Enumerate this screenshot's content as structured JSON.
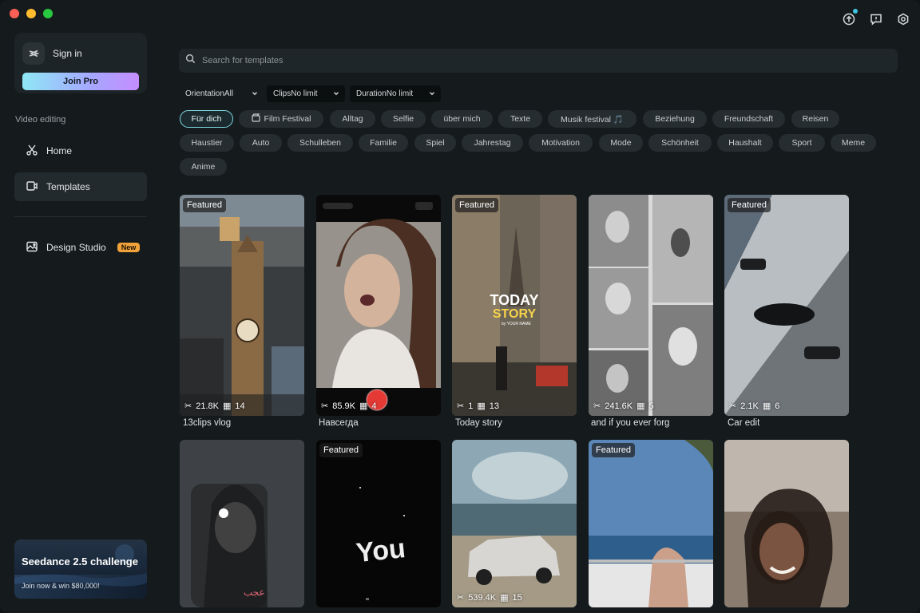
{
  "sidebar": {
    "sign_in": "Sign in",
    "join_pro": "Join Pro",
    "section": "Video editing",
    "items": [
      {
        "label": "Home",
        "icon": "scissors-icon"
      },
      {
        "label": "Templates",
        "icon": "template-icon"
      },
      {
        "label": "Design Studio",
        "icon": "design-icon",
        "badge": "New"
      }
    ],
    "promo": {
      "title": "Seedance 2.5 challenge",
      "subtitle": "Join now & win $80,000!"
    }
  },
  "search": {
    "placeholder": "Search for templates"
  },
  "filters": [
    {
      "label": "Orientation",
      "value": "All"
    },
    {
      "label": "Clips",
      "value": "No limit"
    },
    {
      "label": "Duration",
      "value": "No limit"
    }
  ],
  "chips_row1": [
    "Für dich",
    "Film Festival",
    "Alltag",
    "Selfie",
    "über mich",
    "Texte",
    "Musik festival 🎵",
    "Beziehung",
    "Freundschaft",
    "Reisen"
  ],
  "chips_row2": [
    "Haustier",
    "Auto",
    "Schulleben",
    "Familie",
    "Spiel",
    "Jahrestag",
    "Motivation",
    "Mode",
    "Schönheit",
    "Haushalt",
    "Sport",
    "Meme"
  ],
  "chips_row3": [
    "Anime"
  ],
  "templates": [
    {
      "title": "13clips vlog",
      "featured": "Featured",
      "uses": "21.8K",
      "clips": "14"
    },
    {
      "title": "Навсегда",
      "featured": "",
      "uses": "85.9K",
      "clips": "4"
    },
    {
      "title": "Today story",
      "featured": "Featured",
      "uses": "1",
      "clips": "13"
    },
    {
      "title": "and if you ever forg",
      "featured": "",
      "uses": "241.6K",
      "clips": "5"
    },
    {
      "title": "Car edit",
      "featured": "Featured",
      "uses": "2.1K",
      "clips": "6"
    },
    {
      "title": "",
      "featured": "",
      "uses": "",
      "clips": ""
    },
    {
      "title": "",
      "featured": "Featured",
      "uses": "",
      "clips": ""
    },
    {
      "title": "",
      "featured": "",
      "uses": "539.4K",
      "clips": "15"
    },
    {
      "title": "",
      "featured": "Featured",
      "uses": "",
      "clips": ""
    },
    {
      "title": "",
      "featured": "",
      "uses": "",
      "clips": ""
    }
  ],
  "overlay_text": {
    "today": "TODAY",
    "story": "STORY",
    "by": "by YOUR NAME",
    "you": "You"
  },
  "colors": {
    "accent": "#7fd7e2",
    "badge": "#f1a33a",
    "record": "#e53935"
  }
}
